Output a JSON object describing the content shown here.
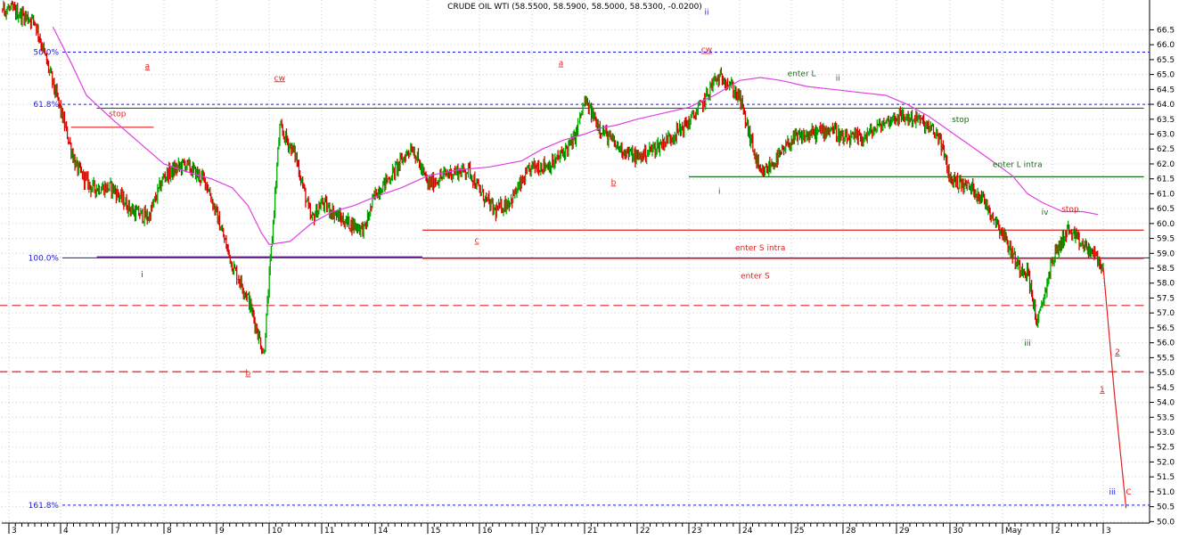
{
  "chart_data": {
    "type": "candlestick",
    "title": "CRUDE OIL WTI (58.5500, 58.5900, 58.5000, 58.5300, -0.0200)",
    "ylim": [
      49.95,
      67.5
    ],
    "y_ticks": [
      50.0,
      50.5,
      51.0,
      51.5,
      52.0,
      52.5,
      53.0,
      53.5,
      54.0,
      54.5,
      55.0,
      55.5,
      56.0,
      56.5,
      57.0,
      57.5,
      58.0,
      58.5,
      59.0,
      59.5,
      60.0,
      60.5,
      61.0,
      61.5,
      62.0,
      62.5,
      63.0,
      63.5,
      64.0,
      64.5,
      65.0,
      65.5,
      66.0,
      66.5
    ],
    "x_ticks": [
      "3",
      "4",
      "7",
      "8",
      "9",
      "10",
      "11",
      "14",
      "15",
      "16",
      "17",
      "21",
      "22",
      "23",
      "24",
      "25",
      "28",
      "29",
      "30",
      "May",
      "2",
      "3"
    ],
    "x_day_index": [
      0,
      1,
      2,
      3,
      4,
      5,
      6,
      7,
      8,
      9,
      10,
      11,
      12,
      13,
      14,
      15,
      16,
      17,
      18,
      19,
      20,
      21
    ],
    "price_path_by_day": {
      "day": [
        0.0,
        0.5,
        0.8,
        1.0,
        1.3,
        1.6,
        2.0,
        2.4,
        2.7,
        3.0,
        3.4,
        3.8,
        4.0,
        4.3,
        4.6,
        4.9,
        5.0,
        5.2,
        5.5,
        5.8,
        6.0,
        6.4,
        6.8,
        7.0,
        7.3,
        7.7,
        8.0,
        8.4,
        8.8,
        9.0,
        9.3,
        9.6,
        10.0,
        10.4,
        10.8,
        11.0,
        11.3,
        11.6,
        12.0,
        12.4,
        12.8,
        13.0,
        13.3,
        13.5,
        13.7,
        14.0,
        14.4,
        14.8,
        15.0,
        15.4,
        15.8,
        16.0,
        16.4,
        16.7,
        17.0,
        17.4,
        17.8,
        18.0,
        18.4,
        18.6,
        18.8,
        19.0,
        19.3,
        19.5,
        19.7,
        20.0,
        20.3,
        20.5,
        20.8,
        21.0
      ],
      "price": [
        67.2,
        66.8,
        65.0,
        63.8,
        61.9,
        61.2,
        61.2,
        60.4,
        60.2,
        61.6,
        62.0,
        61.4,
        60.3,
        58.6,
        57.5,
        55.6,
        58.1,
        63.2,
        62.3,
        60.1,
        60.7,
        60.1,
        59.8,
        61.0,
        61.6,
        62.6,
        61.3,
        61.7,
        61.8,
        61.1,
        60.4,
        60.8,
        61.9,
        62.0,
        62.8,
        64.1,
        63.2,
        62.6,
        62.2,
        62.6,
        63.1,
        63.4,
        64.1,
        64.8,
        64.9,
        64.2,
        61.6,
        62.3,
        62.8,
        63.0,
        63.2,
        62.8,
        62.9,
        63.3,
        63.6,
        63.5,
        62.9,
        61.5,
        61.2,
        60.9,
        60.3,
        59.7,
        58.6,
        58.4,
        56.6,
        58.8,
        59.8,
        59.4,
        59.0,
        58.5
      ]
    },
    "ma_path_by_day": {
      "day": [
        0.85,
        1.2,
        1.5,
        2.0,
        2.6,
        3.0,
        3.5,
        3.9,
        4.3,
        4.6,
        4.85,
        5.0,
        5.4,
        5.8,
        6.2,
        6.6,
        7.0,
        7.5,
        8.0,
        8.6,
        9.2,
        9.8,
        10.2,
        10.6,
        11.0,
        11.3,
        11.6,
        12.0,
        12.5,
        13.0,
        13.5,
        13.8,
        14.0,
        14.4,
        14.8,
        15.3,
        15.8,
        16.3,
        16.8,
        17.2,
        17.6,
        18.0,
        18.4,
        18.8,
        19.2,
        19.5,
        19.8,
        20.2,
        20.6,
        20.9
      ],
      "price": [
        66.6,
        65.4,
        64.3,
        63.5,
        62.6,
        62.0,
        61.7,
        61.5,
        61.2,
        60.6,
        59.7,
        59.3,
        59.4,
        60.0,
        60.4,
        60.6,
        60.9,
        61.2,
        61.6,
        61.8,
        61.9,
        62.1,
        62.5,
        62.8,
        63.0,
        63.2,
        63.3,
        63.5,
        63.7,
        63.9,
        64.3,
        64.6,
        64.8,
        64.9,
        64.8,
        64.6,
        64.5,
        64.4,
        64.3,
        64.0,
        63.6,
        63.1,
        62.6,
        62.1,
        61.6,
        61.0,
        60.7,
        60.4,
        60.4,
        60.3
      ]
    },
    "projection": {
      "day": [
        21.0,
        21.22,
        21.45
      ],
      "price": [
        58.53,
        54.3,
        50.45
      ]
    },
    "fib_levels": [
      {
        "label": "50.0%",
        "price": 65.75
      },
      {
        "label": "61.8%",
        "price": 64.0
      },
      {
        "label": "100.0%",
        "price": 58.85
      },
      {
        "label": "161.8%",
        "price": 50.55
      }
    ],
    "horizontal_lines": [
      {
        "price": 63.87,
        "from_day": 1.7,
        "to_day": 21.8,
        "color": "#1f6b1f"
      },
      {
        "price": 61.57,
        "from_day": 13.0,
        "to_day": 21.8,
        "color": "#1f6b1f"
      },
      {
        "price": 59.78,
        "from_day": 7.9,
        "to_day": 21.8,
        "color": "#e02020"
      },
      {
        "price": 58.83,
        "from_day": 7.9,
        "to_day": 21.8,
        "color": "#e02020"
      },
      {
        "price": 58.87,
        "from_day": 1.7,
        "to_day": 7.9,
        "color": "#6a1f8f"
      },
      {
        "price": 63.23,
        "from_day": 1.2,
        "to_day": 2.8,
        "color": "#e02020"
      },
      {
        "price": 57.25,
        "from_day": -0.2,
        "to_day": 21.8,
        "color": "#e02020",
        "dash": "10,5"
      },
      {
        "price": 55.03,
        "from_day": -0.2,
        "to_day": 21.8,
        "color": "#e02020",
        "dash": "10,5"
      }
    ],
    "annotations": [
      {
        "text": "a",
        "day": 2.68,
        "price": 65.2,
        "color": "#e02020"
      },
      {
        "text": "stop",
        "day": 2.1,
        "price": 63.6,
        "color": "#e02020"
      },
      {
        "text": "i",
        "day": 2.58,
        "price": 58.2,
        "color": "#1a1ad0"
      },
      {
        "text": "b",
        "day": 4.6,
        "price": 54.9,
        "color": "#e02020"
      },
      {
        "text": "cw",
        "day": 5.2,
        "price": 64.8,
        "color": "#e02020"
      },
      {
        "text": "a",
        "day": 10.55,
        "price": 65.3,
        "color": "#e02020"
      },
      {
        "text": "c",
        "day": 8.95,
        "price": 59.35,
        "color": "#e02020"
      },
      {
        "text": "b",
        "day": 11.55,
        "price": 61.3,
        "color": "#e02020"
      },
      {
        "text": "ii",
        "day": 13.35,
        "price": 67.0,
        "color": "#1a1ad0"
      },
      {
        "text": "cw",
        "day": 13.35,
        "price": 65.75,
        "color": "#e02020"
      },
      {
        "text": "i",
        "day": 13.6,
        "price": 61.0,
        "color": "#1f6b1f"
      },
      {
        "text": "enter L",
        "day": 15.2,
        "price": 64.95,
        "color": "#1f6b1f"
      },
      {
        "text": "ii",
        "day": 15.9,
        "price": 64.8,
        "color": "#1f6b1f"
      },
      {
        "text": "stop",
        "day": 18.2,
        "price": 63.4,
        "color": "#1f6b1f"
      },
      {
        "text": "enter L intra",
        "day": 19.3,
        "price": 61.9,
        "color": "#1f6b1f"
      },
      {
        "text": "enter S intra",
        "day": 14.4,
        "price": 59.1,
        "color": "#e02020"
      },
      {
        "text": "enter S",
        "day": 14.3,
        "price": 58.15,
        "color": "#e02020"
      },
      {
        "text": "iv",
        "day": 19.85,
        "price": 60.3,
        "color": "#1f6b1f"
      },
      {
        "text": "stop",
        "day": 20.35,
        "price": 60.4,
        "color": "#e02020"
      },
      {
        "text": "iii",
        "day": 19.5,
        "price": 55.9,
        "color": "#1f6b1f"
      },
      {
        "text": "2",
        "day": 21.28,
        "price": 55.6,
        "color": "#e02020"
      },
      {
        "text": "1",
        "day": 20.98,
        "price": 54.35,
        "color": "#e02020"
      },
      {
        "text": "iii",
        "day": 21.18,
        "price": 50.9,
        "color": "#1a1ad0"
      },
      {
        "text": "C",
        "day": 21.5,
        "price": 50.9,
        "color": "#e02020"
      }
    ],
    "colors": {
      "up": "#00aa00",
      "down": "#dd0000",
      "ma": "#e040e0",
      "projection": "#e02020",
      "fib": "#1a1ad0"
    }
  }
}
